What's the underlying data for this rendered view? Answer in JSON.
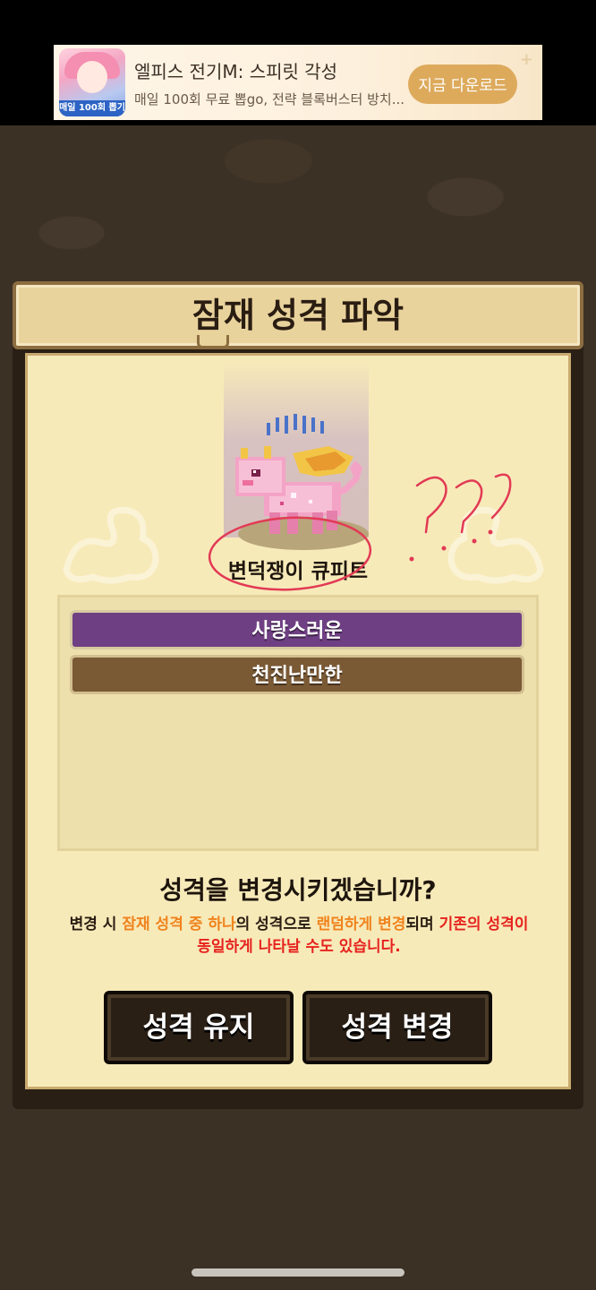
{
  "ad": {
    "thumb_label": "매일 100회 뽑기",
    "title": "엘피스 전기M: 스피릿 각성",
    "subtitle": "매일 100회 무료 뽑go, 전략 블록버스터 방치...",
    "button_label": "지금 다운로드",
    "close_glyph": "+"
  },
  "dialog": {
    "title": "잠재 성격 파악",
    "creature_name": "변덕쟁이 큐피트",
    "traits": [
      "사랑스러운",
      "천진난만한"
    ],
    "question": "성격을 변경시키겠습니까?",
    "notice": {
      "part1": "변경 시 ",
      "part2": "잠재 성격 중 하나",
      "part3": "의 성격으로 ",
      "part4": "랜덤하게 변경",
      "part5": "되며 ",
      "part6": "기존의 성격이 동일하게 나타날 수도 있습니다."
    },
    "keep_button": "성격 유지",
    "change_button": "성격 변경"
  },
  "colors": {
    "panel": "#f7eab9",
    "trait_selected": "#6f3f83",
    "trait_default": "#7a5935",
    "highlight_orange": "#f0831d",
    "highlight_red": "#e6231e",
    "annotation_pen": "#e23a55"
  },
  "annotation": {
    "scribble_text": "???"
  }
}
